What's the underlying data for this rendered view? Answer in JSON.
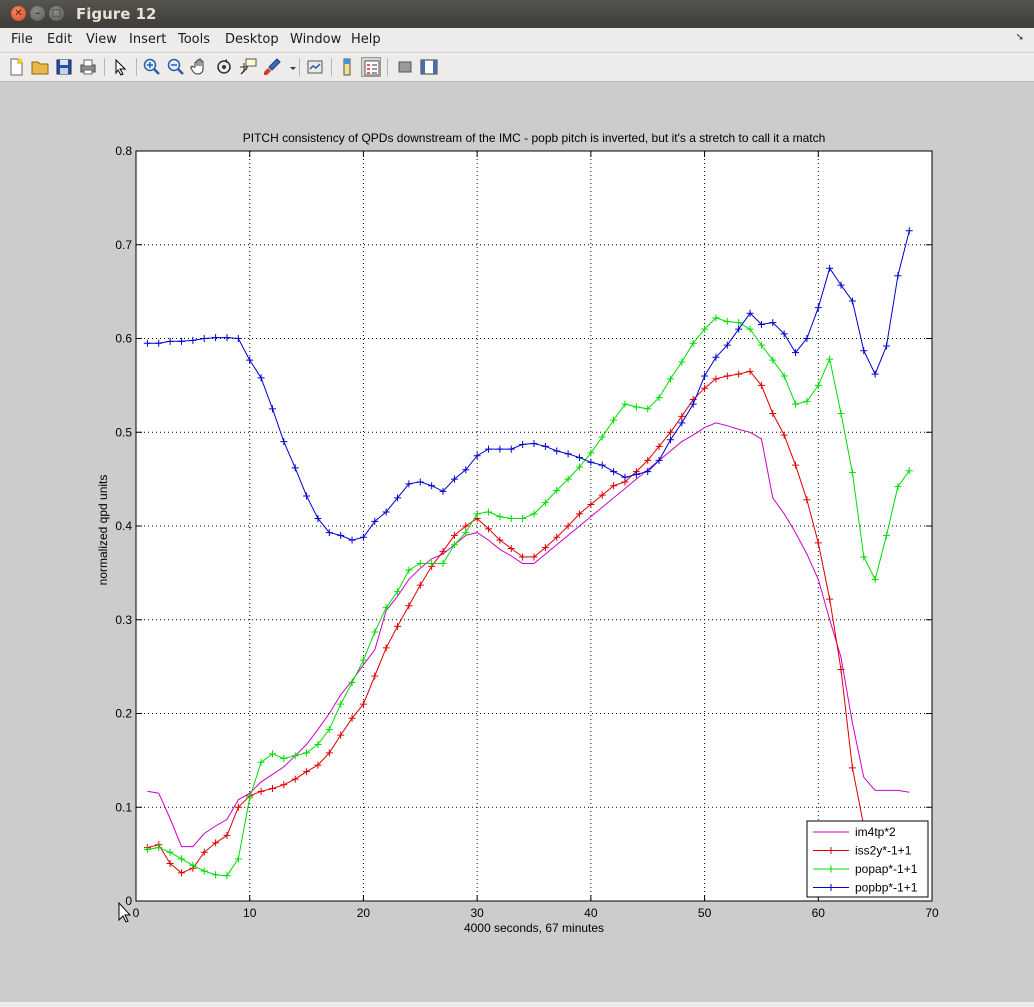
{
  "window": {
    "title": "Figure 12"
  },
  "menu": {
    "items": [
      "File",
      "Edit",
      "View",
      "Insert",
      "Tools",
      "Desktop",
      "Window",
      "Help"
    ]
  },
  "toolbar": {
    "buttons": [
      "new-figure",
      "open-file",
      "save-figure",
      "print-figure",
      "edit-plot",
      "zoom-in",
      "zoom-out",
      "pan",
      "rotate-3d",
      "data-cursor",
      "brush",
      "link-plot",
      "insert-colorbar",
      "insert-legend",
      "hide-plot-tools",
      "show-plot-tools"
    ]
  },
  "chart_data": {
    "type": "line",
    "title": "PITCH consistency of QPDs downstream of the IMC - popb pitch is inverted, but it's a stretch to call it a match",
    "xlabel": "4000 seconds, 67 minutes",
    "ylabel": "normalized qpd units",
    "xlim": [
      0,
      70
    ],
    "ylim": [
      0,
      0.8
    ],
    "xticks": [
      "0",
      "10",
      "20",
      "30",
      "40",
      "50",
      "60",
      "70"
    ],
    "yticks": [
      "0",
      "0.1",
      "0.2",
      "0.3",
      "0.4",
      "0.5",
      "0.6",
      "0.7",
      "0.8"
    ],
    "grid": true,
    "legend_position": "bottom-right",
    "series": [
      {
        "name": "im4tp*2",
        "color": "#cc00cc",
        "marker": "none",
        "x": [
          1,
          2,
          3,
          4,
          5,
          6,
          7,
          8,
          9,
          10,
          11,
          12,
          13,
          14,
          15,
          16,
          17,
          18,
          19,
          20,
          21,
          22,
          23,
          24,
          25,
          26,
          27,
          28,
          29,
          30,
          31,
          32,
          33,
          34,
          35,
          36,
          37,
          38,
          39,
          40,
          41,
          42,
          43,
          44,
          45,
          46,
          47,
          48,
          49,
          50,
          51,
          52,
          53,
          54,
          55,
          56,
          57,
          58,
          59,
          60,
          61,
          62,
          63,
          64,
          65,
          66,
          67,
          68
        ],
        "y": [
          0.117,
          0.115,
          0.088,
          0.058,
          0.058,
          0.072,
          0.08,
          0.087,
          0.108,
          0.115,
          0.127,
          0.135,
          0.143,
          0.155,
          0.167,
          0.183,
          0.2,
          0.22,
          0.235,
          0.252,
          0.268,
          0.31,
          0.325,
          0.343,
          0.355,
          0.365,
          0.37,
          0.38,
          0.39,
          0.393,
          0.385,
          0.375,
          0.368,
          0.36,
          0.36,
          0.37,
          0.38,
          0.39,
          0.4,
          0.41,
          0.42,
          0.43,
          0.44,
          0.45,
          0.46,
          0.47,
          0.48,
          0.49,
          0.497,
          0.505,
          0.51,
          0.507,
          0.503,
          0.5,
          0.493,
          0.43,
          0.413,
          0.393,
          0.37,
          0.343,
          0.3,
          0.26,
          0.19,
          0.132,
          0.118,
          0.118,
          0.118,
          0.116
        ]
      },
      {
        "name": "iss2y*-1+1",
        "color": "#dd0000",
        "marker": "+",
        "x": [
          1,
          2,
          3,
          4,
          5,
          6,
          7,
          8,
          9,
          10,
          11,
          12,
          13,
          14,
          15,
          16,
          17,
          18,
          19,
          20,
          21,
          22,
          23,
          24,
          25,
          26,
          27,
          28,
          29,
          30,
          31,
          32,
          33,
          34,
          35,
          36,
          37,
          38,
          39,
          40,
          41,
          42,
          43,
          44,
          45,
          46,
          47,
          48,
          49,
          50,
          51,
          52,
          53,
          54,
          55,
          56,
          57,
          58,
          59,
          60,
          61,
          62,
          63,
          64
        ],
        "y": [
          0.057,
          0.06,
          0.04,
          0.03,
          0.035,
          0.052,
          0.062,
          0.07,
          0.1,
          0.112,
          0.117,
          0.12,
          0.124,
          0.13,
          0.138,
          0.145,
          0.158,
          0.177,
          0.195,
          0.21,
          0.24,
          0.27,
          0.293,
          0.315,
          0.337,
          0.357,
          0.373,
          0.39,
          0.4,
          0.408,
          0.397,
          0.385,
          0.376,
          0.367,
          0.367,
          0.377,
          0.388,
          0.4,
          0.413,
          0.423,
          0.433,
          0.443,
          0.447,
          0.458,
          0.47,
          0.485,
          0.5,
          0.517,
          0.535,
          0.547,
          0.557,
          0.56,
          0.562,
          0.565,
          0.55,
          0.52,
          0.497,
          0.465,
          0.428,
          0.382,
          0.322,
          0.247,
          0.142,
          0.08
        ]
      },
      {
        "name": "popap*-1+1",
        "color": "#00dd00",
        "marker": "+",
        "x": [
          1,
          2,
          3,
          4,
          5,
          6,
          7,
          8,
          9,
          10,
          11,
          12,
          13,
          14,
          15,
          16,
          17,
          18,
          19,
          20,
          21,
          22,
          23,
          24,
          25,
          26,
          27,
          28,
          29,
          30,
          31,
          32,
          33,
          34,
          35,
          36,
          37,
          38,
          39,
          40,
          41,
          42,
          43,
          44,
          45,
          46,
          47,
          48,
          49,
          50,
          51,
          52,
          53,
          54,
          55,
          56,
          57,
          58,
          59,
          60,
          61,
          62,
          63,
          64,
          65,
          66,
          67,
          68
        ],
        "y": [
          0.055,
          0.057,
          0.052,
          0.045,
          0.038,
          0.032,
          0.028,
          0.027,
          0.045,
          0.11,
          0.148,
          0.157,
          0.152,
          0.155,
          0.158,
          0.167,
          0.183,
          0.21,
          0.233,
          0.257,
          0.287,
          0.313,
          0.33,
          0.353,
          0.36,
          0.36,
          0.36,
          0.38,
          0.393,
          0.413,
          0.415,
          0.41,
          0.408,
          0.408,
          0.413,
          0.425,
          0.438,
          0.45,
          0.463,
          0.478,
          0.495,
          0.513,
          0.53,
          0.527,
          0.525,
          0.537,
          0.557,
          0.575,
          0.595,
          0.61,
          0.622,
          0.618,
          0.617,
          0.61,
          0.593,
          0.577,
          0.56,
          0.53,
          0.533,
          0.55,
          0.578,
          0.52,
          0.457,
          0.367,
          0.343,
          0.39,
          0.442,
          0.459
        ]
      },
      {
        "name": "popbp*-1+1",
        "color": "#0000cc",
        "marker": "+",
        "x": [
          1,
          2,
          3,
          4,
          5,
          6,
          7,
          8,
          9,
          10,
          11,
          12,
          13,
          14,
          15,
          16,
          17,
          18,
          19,
          20,
          21,
          22,
          23,
          24,
          25,
          26,
          27,
          28,
          29,
          30,
          31,
          32,
          33,
          34,
          35,
          36,
          37,
          38,
          39,
          40,
          41,
          42,
          43,
          44,
          45,
          46,
          47,
          48,
          49,
          50,
          51,
          52,
          53,
          54,
          55,
          56,
          57,
          58,
          59,
          60,
          61,
          62,
          63,
          64,
          65,
          66,
          67,
          68
        ],
        "y": [
          0.595,
          0.595,
          0.597,
          0.597,
          0.598,
          0.6,
          0.601,
          0.601,
          0.6,
          0.577,
          0.558,
          0.525,
          0.49,
          0.462,
          0.432,
          0.408,
          0.393,
          0.39,
          0.385,
          0.388,
          0.405,
          0.415,
          0.43,
          0.445,
          0.447,
          0.443,
          0.437,
          0.45,
          0.46,
          0.475,
          0.482,
          0.482,
          0.482,
          0.487,
          0.488,
          0.485,
          0.48,
          0.477,
          0.473,
          0.468,
          0.465,
          0.458,
          0.452,
          0.455,
          0.458,
          0.47,
          0.492,
          0.51,
          0.53,
          0.56,
          0.58,
          0.593,
          0.61,
          0.627,
          0.615,
          0.617,
          0.605,
          0.585,
          0.6,
          0.633,
          0.675,
          0.657,
          0.64,
          0.587,
          0.562,
          0.592,
          0.667,
          0.715
        ]
      }
    ]
  }
}
